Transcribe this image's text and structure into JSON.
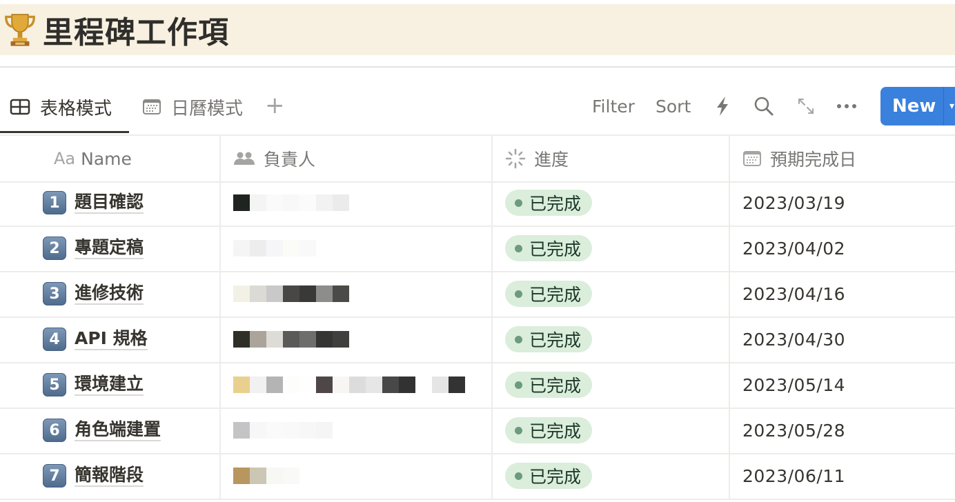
{
  "page": {
    "icon": "trophy-icon",
    "title": "里程碑工作項"
  },
  "views": {
    "tabs": [
      {
        "label": "表格模式",
        "icon": "table-icon",
        "active": true
      },
      {
        "label": "日曆模式",
        "icon": "calendar-icon",
        "active": false
      }
    ],
    "add_view_label": "+"
  },
  "toolbar": {
    "filter_label": "Filter",
    "sort_label": "Sort",
    "automation_icon": "lightning-icon",
    "search_icon": "search-icon",
    "expand_icon": "expand-icon",
    "more_label": "•••",
    "new_label": "New",
    "new_caret": "▾"
  },
  "table": {
    "columns": [
      {
        "label": "Name",
        "icon": "text-property-icon",
        "icon_text": "Aa"
      },
      {
        "label": "負責人",
        "icon": "people-icon"
      },
      {
        "label": "進度",
        "icon": "status-icon"
      },
      {
        "label": "預期完成日",
        "icon": "calendar-icon"
      }
    ],
    "rows": [
      {
        "number": "1",
        "name": "題目確認",
        "assignee": "(redacted)",
        "status": "已完成",
        "due": "2023/03/19"
      },
      {
        "number": "2",
        "name": "專題定稿",
        "assignee": "(redacted)",
        "status": "已完成",
        "due": "2023/04/02"
      },
      {
        "number": "3",
        "name": "進修技術",
        "assignee": "(redacted)",
        "status": "已完成",
        "due": "2023/04/16"
      },
      {
        "number": "4",
        "name": "API 規格",
        "assignee": "(redacted)",
        "status": "已完成",
        "due": "2023/04/30"
      },
      {
        "number": "5",
        "name": "環境建立",
        "assignee": "(redacted)",
        "status": "已完成",
        "due": "2023/05/14"
      },
      {
        "number": "6",
        "name": "角色端建置",
        "assignee": "(redacted)",
        "status": "已完成",
        "due": "2023/05/28"
      },
      {
        "number": "7",
        "name": "簡報階段",
        "assignee": "(redacted)",
        "status": "已完成",
        "due": "2023/06/11"
      }
    ]
  },
  "colors": {
    "title_band": "#f8f1e1",
    "accent_blue": "#3a80dd",
    "status_done_bg": "#dbeddb",
    "status_done_dot": "#6c9b7d",
    "grid_line": "#ececea"
  }
}
